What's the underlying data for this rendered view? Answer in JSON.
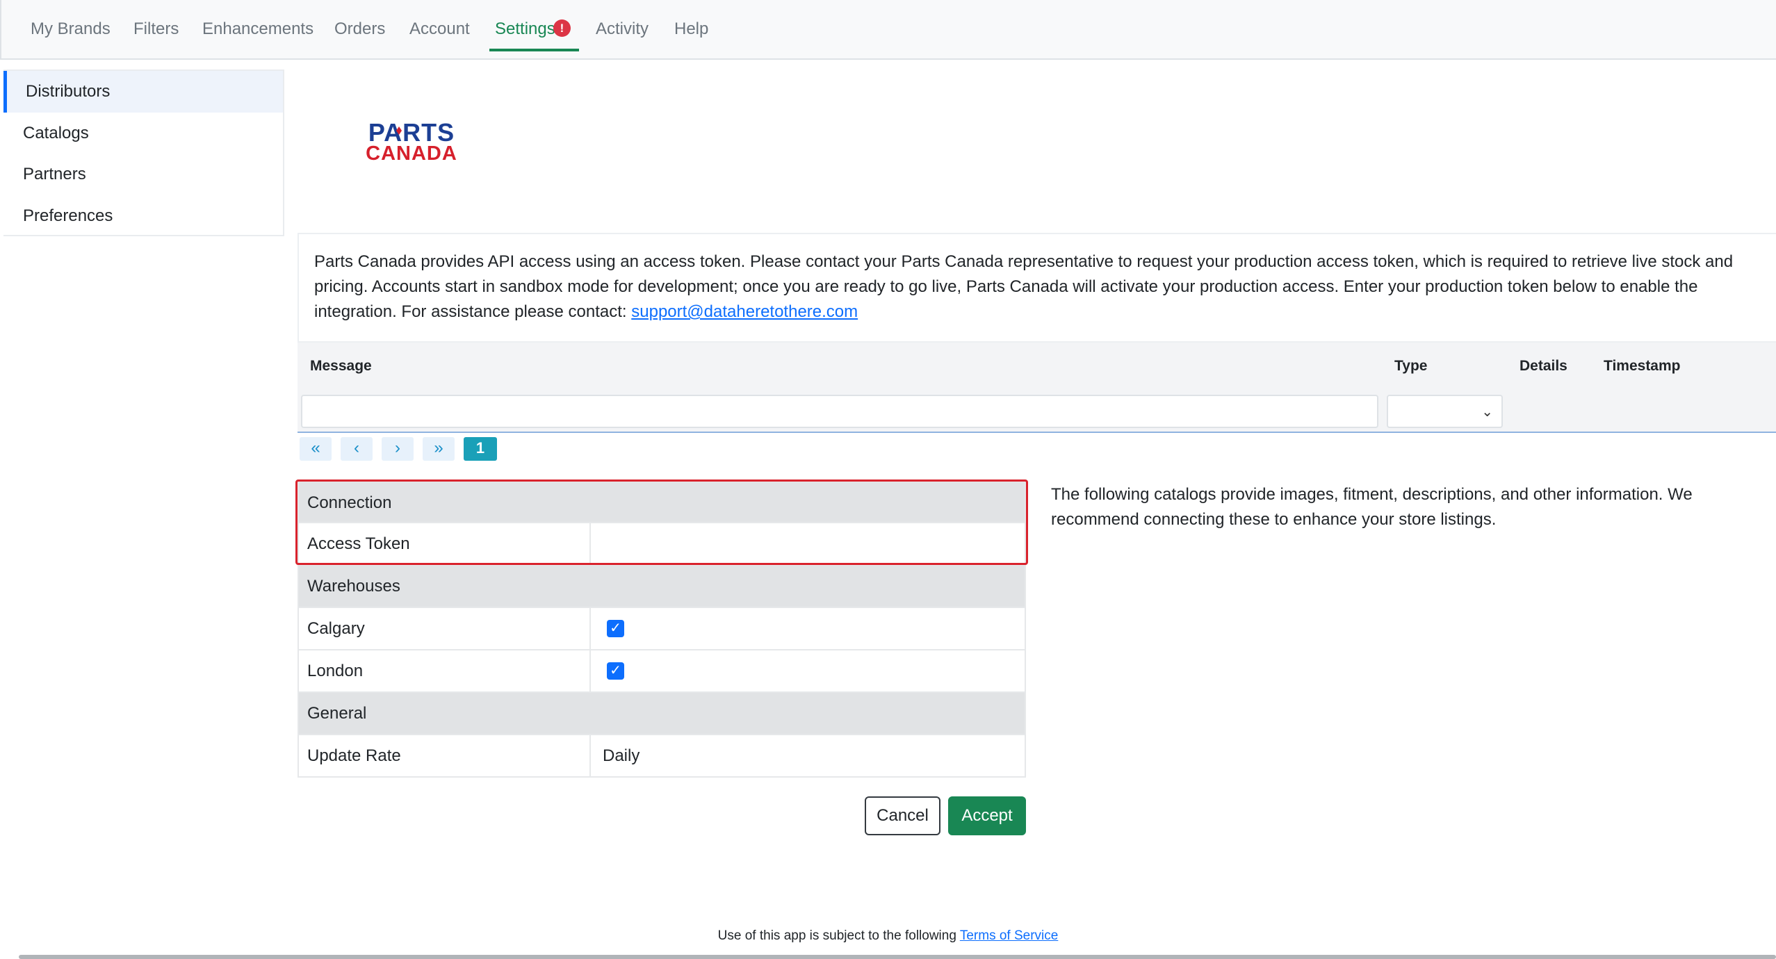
{
  "nav": {
    "tabs": [
      {
        "label": "My Brands"
      },
      {
        "label": "Filters"
      },
      {
        "label": "Enhancements"
      },
      {
        "label": "Orders"
      },
      {
        "label": "Account"
      },
      {
        "label": "Settings",
        "active": true,
        "badge": "!"
      },
      {
        "label": "Activity"
      },
      {
        "label": "Help"
      }
    ]
  },
  "sidebar": {
    "items": [
      {
        "label": "Distributors",
        "active": true
      },
      {
        "label": "Catalogs"
      },
      {
        "label": "Partners"
      },
      {
        "label": "Preferences"
      }
    ]
  },
  "logo": {
    "line1": "PARTS",
    "line2": "CANADA"
  },
  "description": {
    "text": "Parts Canada provides API access using an access token. Please contact your Parts Canada representative to request your production access token, which is required to retrieve live stock and pricing. Accounts start in sandbox mode for development; once you are ready to go live, Parts Canada will activate your production access. Enter your production token below to enable the integration. For assistance please contact: ",
    "email": "support@dataheretothere.com"
  },
  "grid": {
    "columns": [
      "Message",
      "Type",
      "Details",
      "Timestamp"
    ],
    "message_filter": "",
    "type_filter": ""
  },
  "pager": {
    "first": "«",
    "prev": "‹",
    "next": "›",
    "last": "»",
    "current": "1"
  },
  "settings": {
    "connection_header": "Connection",
    "access_token_label": "Access Token",
    "access_token_value": "",
    "warehouses_header": "Warehouses",
    "warehouses": [
      {
        "label": "Calgary",
        "checked": true
      },
      {
        "label": "London",
        "checked": true
      }
    ],
    "general_header": "General",
    "update_rate_label": "Update Rate",
    "update_rate_value": "Daily"
  },
  "catalog_note": "The following catalogs provide images, fitment, descriptions, and other information. We recommend connecting these to enhance your store listings.",
  "buttons": {
    "cancel": "Cancel",
    "accept": "Accept"
  },
  "footer": {
    "text": "Use of this app is subject to the following ",
    "link": "Terms of Service"
  },
  "colors": {
    "accent": "#198754",
    "highlight": "#d9232d",
    "logo_blue": "#1c3f94",
    "logo_red": "#d6202c"
  }
}
